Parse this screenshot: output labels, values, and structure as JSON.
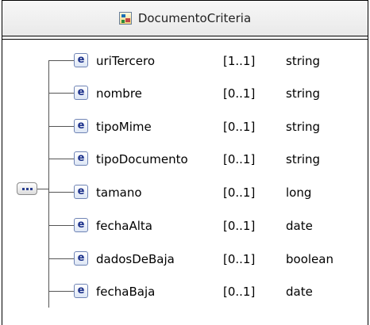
{
  "header": {
    "title": "DocumentoCriteria",
    "icon": "complex-type-icon"
  },
  "sequence": {
    "icon": "sequence-icon"
  },
  "elements": [
    {
      "name": "uriTercero",
      "cardinality": "[1..1]",
      "type": "string",
      "icon_letter": "e"
    },
    {
      "name": "nombre",
      "cardinality": "[0..1]",
      "type": "string",
      "icon_letter": "e"
    },
    {
      "name": "tipoMime",
      "cardinality": "[0..1]",
      "type": "string",
      "icon_letter": "e"
    },
    {
      "name": "tipoDocumento",
      "cardinality": "[0..1]",
      "type": "string",
      "icon_letter": "e"
    },
    {
      "name": "tamano",
      "cardinality": "[0..1]",
      "type": "long",
      "icon_letter": "e"
    },
    {
      "name": "fechaAlta",
      "cardinality": "[0..1]",
      "type": "date",
      "icon_letter": "e"
    },
    {
      "name": "dadosDeBaja",
      "cardinality": "[0..1]",
      "type": "boolean",
      "icon_letter": "e"
    },
    {
      "name": "fechaBaja",
      "cardinality": "[0..1]",
      "type": "date",
      "icon_letter": "e"
    }
  ]
}
